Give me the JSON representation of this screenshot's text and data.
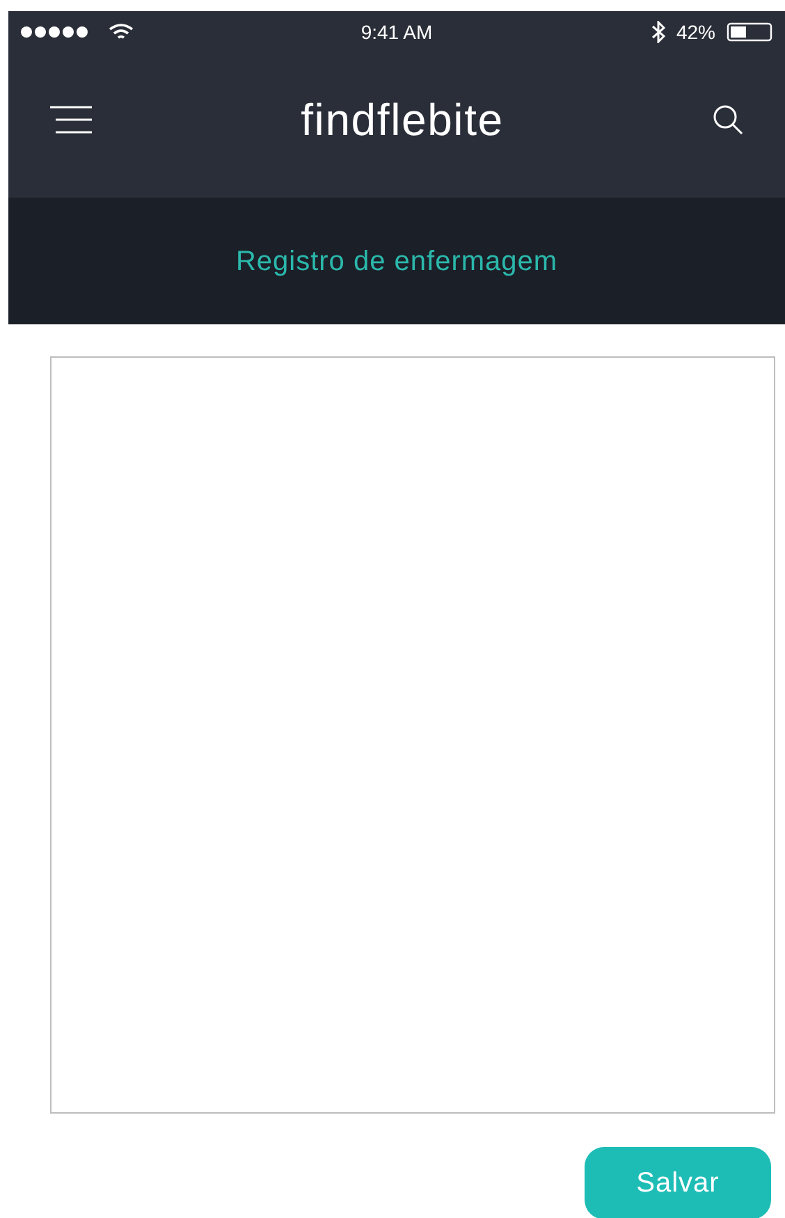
{
  "status_bar": {
    "time": "9:41 AM",
    "battery": "42%"
  },
  "header": {
    "title": "findflebite"
  },
  "subheader": {
    "title": "Registro de enfermagem"
  },
  "save_button": {
    "label": "Salvar"
  }
}
